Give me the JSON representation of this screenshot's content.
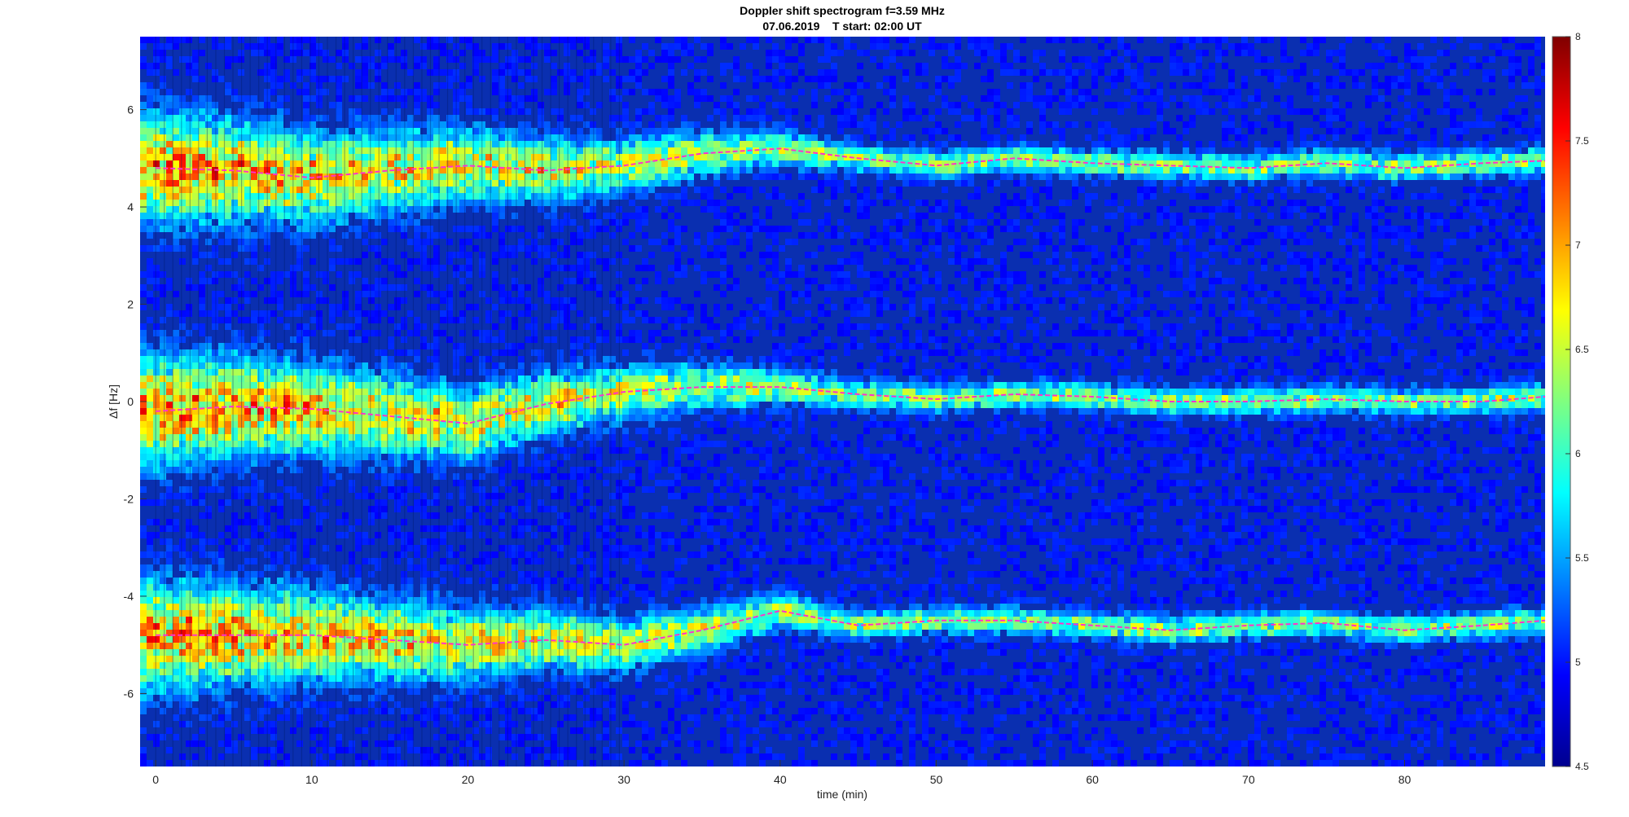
{
  "chart_data": {
    "type": "heatmap",
    "title": "Doppler shift spectrogram f=3.59 MHz",
    "subtitle": "07.06.2019    T start: 02:00 UT",
    "xlabel": "time (min)",
    "ylabel": "Δf [Hz]",
    "xlim": [
      -1,
      89
    ],
    "ylim": [
      -7.5,
      7.5
    ],
    "x_ticks": [
      0,
      10,
      20,
      30,
      40,
      50,
      60,
      70,
      80
    ],
    "y_ticks": [
      -6,
      -4,
      -2,
      0,
      2,
      4,
      6
    ],
    "colorbar": {
      "range": [
        4.5,
        8
      ],
      "ticks": [
        4.5,
        5,
        5.5,
        6,
        6.5,
        7,
        7.5,
        8
      ],
      "colormap": "jet"
    },
    "colors": {
      "background_level": "#0a2fb0",
      "trace": "#ff33cc"
    },
    "grid": false,
    "traces": [
      {
        "x": [
          0,
          5,
          10,
          15,
          20,
          25,
          30,
          35,
          40,
          45,
          50,
          55,
          60,
          65,
          70,
          75,
          80,
          85,
          89
        ],
        "y": [
          4.8,
          4.75,
          4.6,
          4.75,
          4.85,
          4.75,
          4.85,
          5.1,
          5.2,
          5.0,
          4.85,
          5.0,
          4.9,
          4.85,
          4.8,
          4.9,
          4.8,
          4.9,
          4.95
        ]
      },
      {
        "x": [
          0,
          5,
          10,
          15,
          20,
          25,
          30,
          35,
          40,
          45,
          50,
          55,
          60,
          65,
          70,
          75,
          80,
          85,
          89
        ],
        "y": [
          -0.2,
          -0.1,
          -0.15,
          -0.3,
          -0.45,
          -0.05,
          0.2,
          0.3,
          0.3,
          0.15,
          0.05,
          0.15,
          0.1,
          0.0,
          0.0,
          0.05,
          0.0,
          0.0,
          0.1
        ]
      },
      {
        "x": [
          0,
          5,
          10,
          15,
          20,
          25,
          30,
          35,
          40,
          45,
          50,
          55,
          60,
          65,
          70,
          75,
          80,
          85,
          89
        ],
        "y": [
          -4.8,
          -4.8,
          -4.8,
          -4.9,
          -5.0,
          -4.9,
          -5.0,
          -4.7,
          -4.3,
          -4.6,
          -4.5,
          -4.5,
          -4.6,
          -4.7,
          -4.6,
          -4.55,
          -4.7,
          -4.6,
          -4.5
        ]
      }
    ]
  }
}
